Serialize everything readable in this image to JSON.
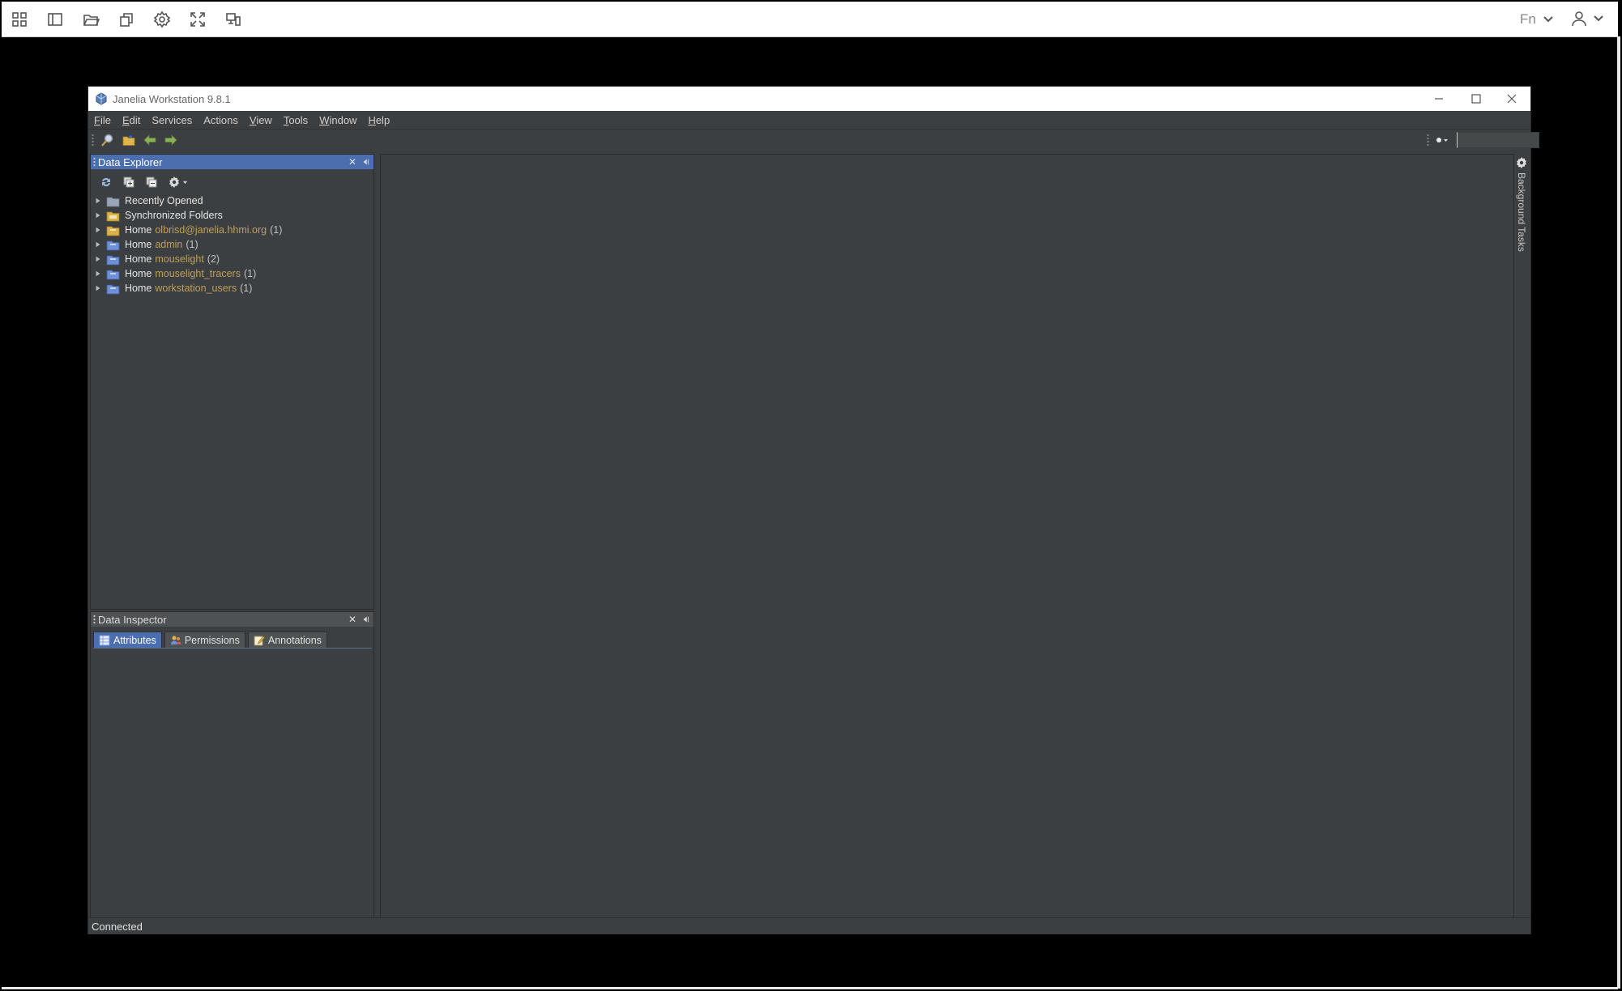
{
  "remote_toolbar": {
    "fn_label": "Fn",
    "icons": [
      "apps-grid-icon",
      "split-view-icon",
      "folder-open-icon",
      "copy-icon",
      "gear-icon",
      "fullscreen-icon",
      "display-icon"
    ]
  },
  "window": {
    "title": "Janelia Workstation 9.8.1"
  },
  "menubar": {
    "items": [
      {
        "mnemonic": "F",
        "rest": "ile"
      },
      {
        "mnemonic": "E",
        "rest": "dit"
      },
      {
        "mnemonic": "",
        "rest": "Services"
      },
      {
        "mnemonic": "",
        "rest": "Actions"
      },
      {
        "mnemonic": "V",
        "rest": "iew"
      },
      {
        "mnemonic": "T",
        "rest": "ools"
      },
      {
        "mnemonic": "W",
        "rest": "indow"
      },
      {
        "mnemonic": "H",
        "rest": "elp"
      }
    ]
  },
  "search": {
    "value": "",
    "placeholder": ""
  },
  "data_explorer": {
    "title": "Data Explorer",
    "tree": [
      {
        "label": "Recently Opened",
        "user": "",
        "count": "",
        "folder_color": "#9aa6b8"
      },
      {
        "label": "Synchronized Folders",
        "user": "",
        "count": "",
        "folder_color": "#d9b34a"
      },
      {
        "label": "Home",
        "user": "olbrisd@janelia.hhmi.org",
        "count": "(1)",
        "folder_color": "#d9b34a"
      },
      {
        "label": "Home",
        "user": "admin",
        "count": "(1)",
        "folder_color": "#6f8fd6"
      },
      {
        "label": "Home",
        "user": "mouselight",
        "count": "(2)",
        "folder_color": "#6f8fd6"
      },
      {
        "label": "Home",
        "user": "mouselight_tracers",
        "count": "(1)",
        "folder_color": "#6f8fd6"
      },
      {
        "label": "Home",
        "user": "workstation_users",
        "count": "(1)",
        "folder_color": "#6f8fd6"
      }
    ]
  },
  "data_inspector": {
    "title": "Data Inspector",
    "tabs": [
      {
        "label": "Attributes",
        "selected": true
      },
      {
        "label": "Permissions",
        "selected": false
      },
      {
        "label": "Annotations",
        "selected": false
      }
    ]
  },
  "side_panel": {
    "label": "Background Tasks"
  },
  "status": {
    "text": "Connected"
  },
  "colors": {
    "accent": "#4b6eaf",
    "background": "#3c3f41",
    "user_text": "#bf9f5a"
  }
}
